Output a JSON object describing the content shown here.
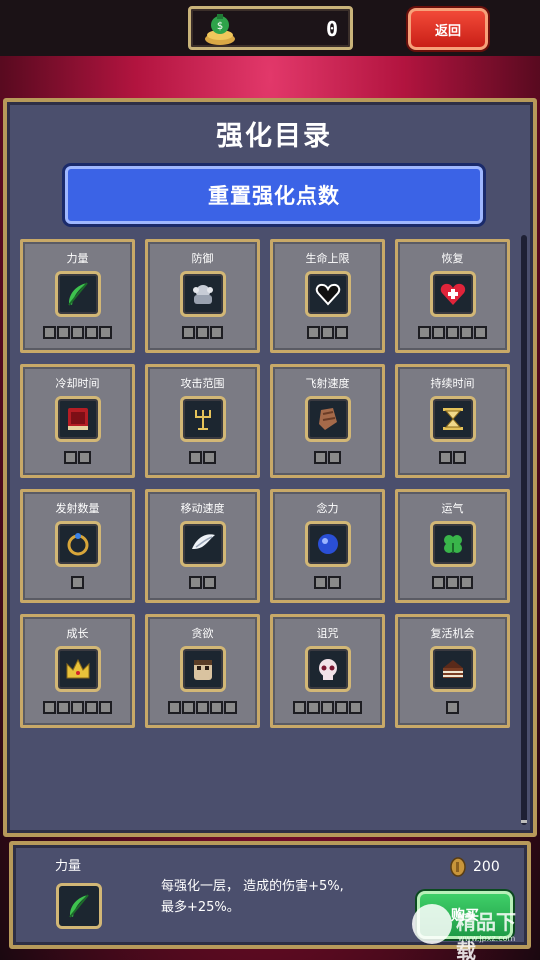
{
  "header": {
    "coin_count": "0",
    "back_label": "返回"
  },
  "panel": {
    "title": "强化目录",
    "reset_label": "重置强化点数"
  },
  "upgrades": [
    {
      "name": "力量",
      "icon": "feather-icon",
      "pips": 5
    },
    {
      "name": "防御",
      "icon": "armor-icon",
      "pips": 3
    },
    {
      "name": "生命上限",
      "icon": "heart-outline-icon",
      "pips": 3
    },
    {
      "name": "恢复",
      "icon": "heart-plus-icon",
      "pips": 5
    },
    {
      "name": "冷却时间",
      "icon": "tome-icon",
      "pips": 2
    },
    {
      "name": "攻击范围",
      "icon": "candelabra-icon",
      "pips": 2
    },
    {
      "name": "飞射速度",
      "icon": "bracer-icon",
      "pips": 2
    },
    {
      "name": "持续时间",
      "icon": "hourglass-icon",
      "pips": 2
    },
    {
      "name": "发射数量",
      "icon": "ring-icon",
      "pips": 1
    },
    {
      "name": "移动速度",
      "icon": "wing-icon",
      "pips": 2
    },
    {
      "name": "念力",
      "icon": "orb-icon",
      "pips": 2
    },
    {
      "name": "运气",
      "icon": "clover-icon",
      "pips": 3
    },
    {
      "name": "成长",
      "icon": "crown-icon",
      "pips": 5
    },
    {
      "name": "贪欲",
      "icon": "mask-icon",
      "pips": 5
    },
    {
      "name": "诅咒",
      "icon": "skull-icon",
      "pips": 5
    },
    {
      "name": "复活机会",
      "icon": "cake-icon",
      "pips": 1
    }
  ],
  "detail": {
    "name": "力量",
    "icon": "feather-icon",
    "desc_line1": "每强化一层， 造成的伤害+5%,",
    "desc_line2": "最多+25%。",
    "price": "200",
    "buy_label": "购买"
  },
  "watermark": {
    "text": "精品下载",
    "url": "www.jpxz.com"
  }
}
